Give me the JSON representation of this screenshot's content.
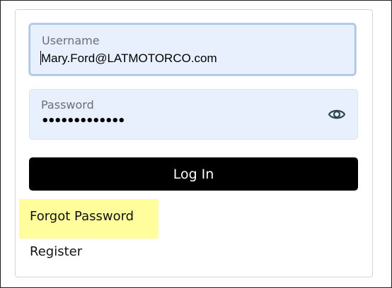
{
  "login_form": {
    "username": {
      "label": "Username",
      "value": "Mary.Ford@LATMOTORCO.com"
    },
    "password": {
      "label": "Password",
      "masked_value": "•••••••••••••",
      "toggle_icon": "eye-icon"
    },
    "login_button_label": "Log In",
    "forgot_password_label": "Forgot Password",
    "register_label": "Register"
  },
  "colors": {
    "field_background": "#e8f0fe",
    "button_background": "#000000",
    "button_text": "#ffffff",
    "highlight": "#fffd9c",
    "icon": "#2f4a4f"
  }
}
